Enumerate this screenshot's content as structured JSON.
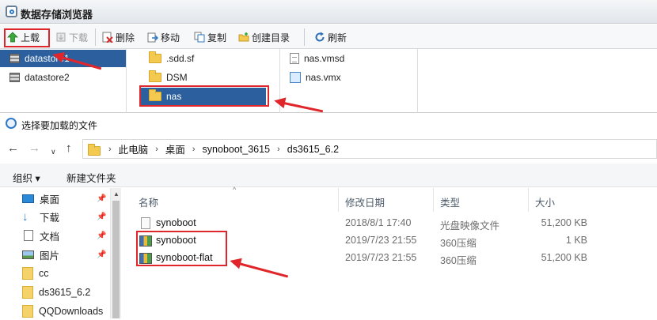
{
  "datastore_browser": {
    "title": "数据存储浏览器",
    "toolbar": {
      "upload": "上载",
      "download": "下载",
      "delete": "删除",
      "move": "移动",
      "copy": "复制",
      "create_dir": "创建目录",
      "refresh": "刷新"
    },
    "datastores": [
      "datastore1",
      "datastore2"
    ],
    "folders": [
      ".sdd.sf",
      "DSM",
      "nas"
    ],
    "files": [
      "nas.vmsd",
      "nas.vmx"
    ]
  },
  "file_dialog": {
    "title": "选择要加载的文件",
    "breadcrumb": [
      "此电脑",
      "桌面",
      "synoboot_3615",
      "ds3615_6.2"
    ],
    "commands": {
      "organize": "组织 ▾",
      "new_folder": "新建文件夹"
    },
    "nav_items": [
      {
        "label": "桌面",
        "icon": "desktop-icon",
        "pinned": true
      },
      {
        "label": "下载",
        "icon": "download-arrow-icon",
        "pinned": true
      },
      {
        "label": "文档",
        "icon": "document-icon",
        "pinned": true
      },
      {
        "label": "图片",
        "icon": "picture-icon",
        "pinned": true
      },
      {
        "label": "cc",
        "icon": "folder-icon",
        "pinned": false
      },
      {
        "label": "ds3615_6.2",
        "icon": "folder-icon",
        "pinned": false
      },
      {
        "label": "QQDownloads",
        "icon": "folder-icon",
        "pinned": false
      }
    ],
    "columns": {
      "name": "名称",
      "date": "修改日期",
      "type": "类型",
      "size": "大小"
    },
    "files": [
      {
        "name": "synoboot",
        "date": "2018/8/1 17:40",
        "type": "光盘映像文件",
        "size": "51,200 KB",
        "icon": "disc-image-icon"
      },
      {
        "name": "synoboot",
        "date": "2019/7/23 21:55",
        "type": "360压缩",
        "size": "1 KB",
        "icon": "archive-icon"
      },
      {
        "name": "synoboot-flat",
        "date": "2019/7/23 21:55",
        "type": "360压缩",
        "size": "51,200 KB",
        "icon": "archive-icon"
      }
    ]
  },
  "colors": {
    "annotation_red": "#e0262a",
    "selection_blue": "#2c5f9e"
  }
}
